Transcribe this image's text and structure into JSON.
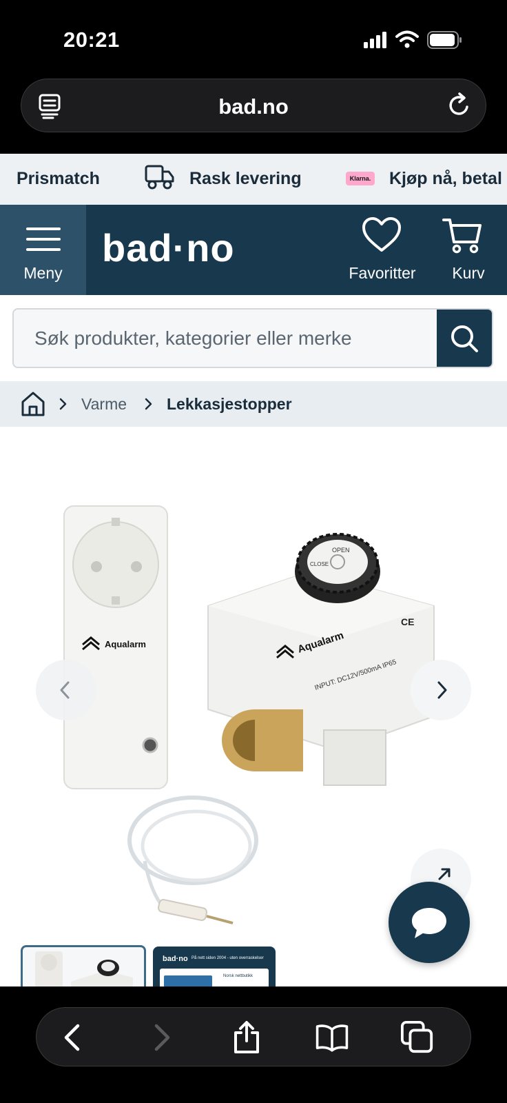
{
  "status_bar": {
    "time": "20:21"
  },
  "browser": {
    "url": "bad.no"
  },
  "promo": {
    "items": [
      "Prismatch",
      "Rask levering",
      "Kjøp nå, betal"
    ],
    "klarna_badge": "Klarna."
  },
  "header": {
    "menu_label": "Meny",
    "logo": "bad·no",
    "favorites_label": "Favoritter",
    "cart_label": "Kurv",
    "brand_color": "#17384d"
  },
  "search": {
    "placeholder": "Søk produkter, kategorier eller merke"
  },
  "breadcrumb": {
    "items": [
      "Varme",
      "Lekkasjestopper"
    ]
  },
  "product": {
    "image_brand": "Aqualarm",
    "valve_label": "INPUT: DC12V/500mA IP65",
    "knob_open": "OPEN",
    "knob_close": "CLOSE"
  },
  "thumbnails": {
    "thumb2_logo": "bad·no",
    "thumb2_tag": "På nett siden 2004 - uten overraskelser",
    "thumb2_text": "Norsk nettbutikk"
  },
  "icons": [
    "tabs-icon",
    "reload-icon",
    "truck-icon",
    "menu-icon",
    "heart-icon",
    "cart-icon",
    "search-icon",
    "home-icon",
    "chevron-left-icon",
    "chevron-right-icon",
    "expand-icon",
    "chat-icon",
    "back-icon",
    "forward-icon",
    "share-icon",
    "bookmarks-icon",
    "tabs-overview-icon"
  ]
}
